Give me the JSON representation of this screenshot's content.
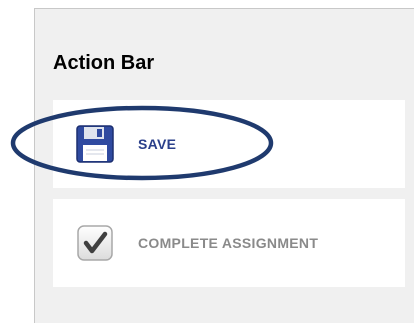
{
  "action_bar": {
    "title": "Action Bar",
    "actions": [
      {
        "label": "SAVE",
        "icon": "floppy-disk-icon",
        "enabled": true
      },
      {
        "label": "COMPLETE ASSIGNMENT",
        "icon": "checkmark-icon",
        "enabled": false
      }
    ]
  },
  "colors": {
    "panel_background": "#f0f0f0",
    "card_background": "#ffffff",
    "save_label": "#2a3f8a",
    "complete_label": "#8a8a8a",
    "highlight_ellipse": "#1f3a6e"
  },
  "annotation": {
    "shape": "ellipse",
    "highlights": "SAVE"
  }
}
